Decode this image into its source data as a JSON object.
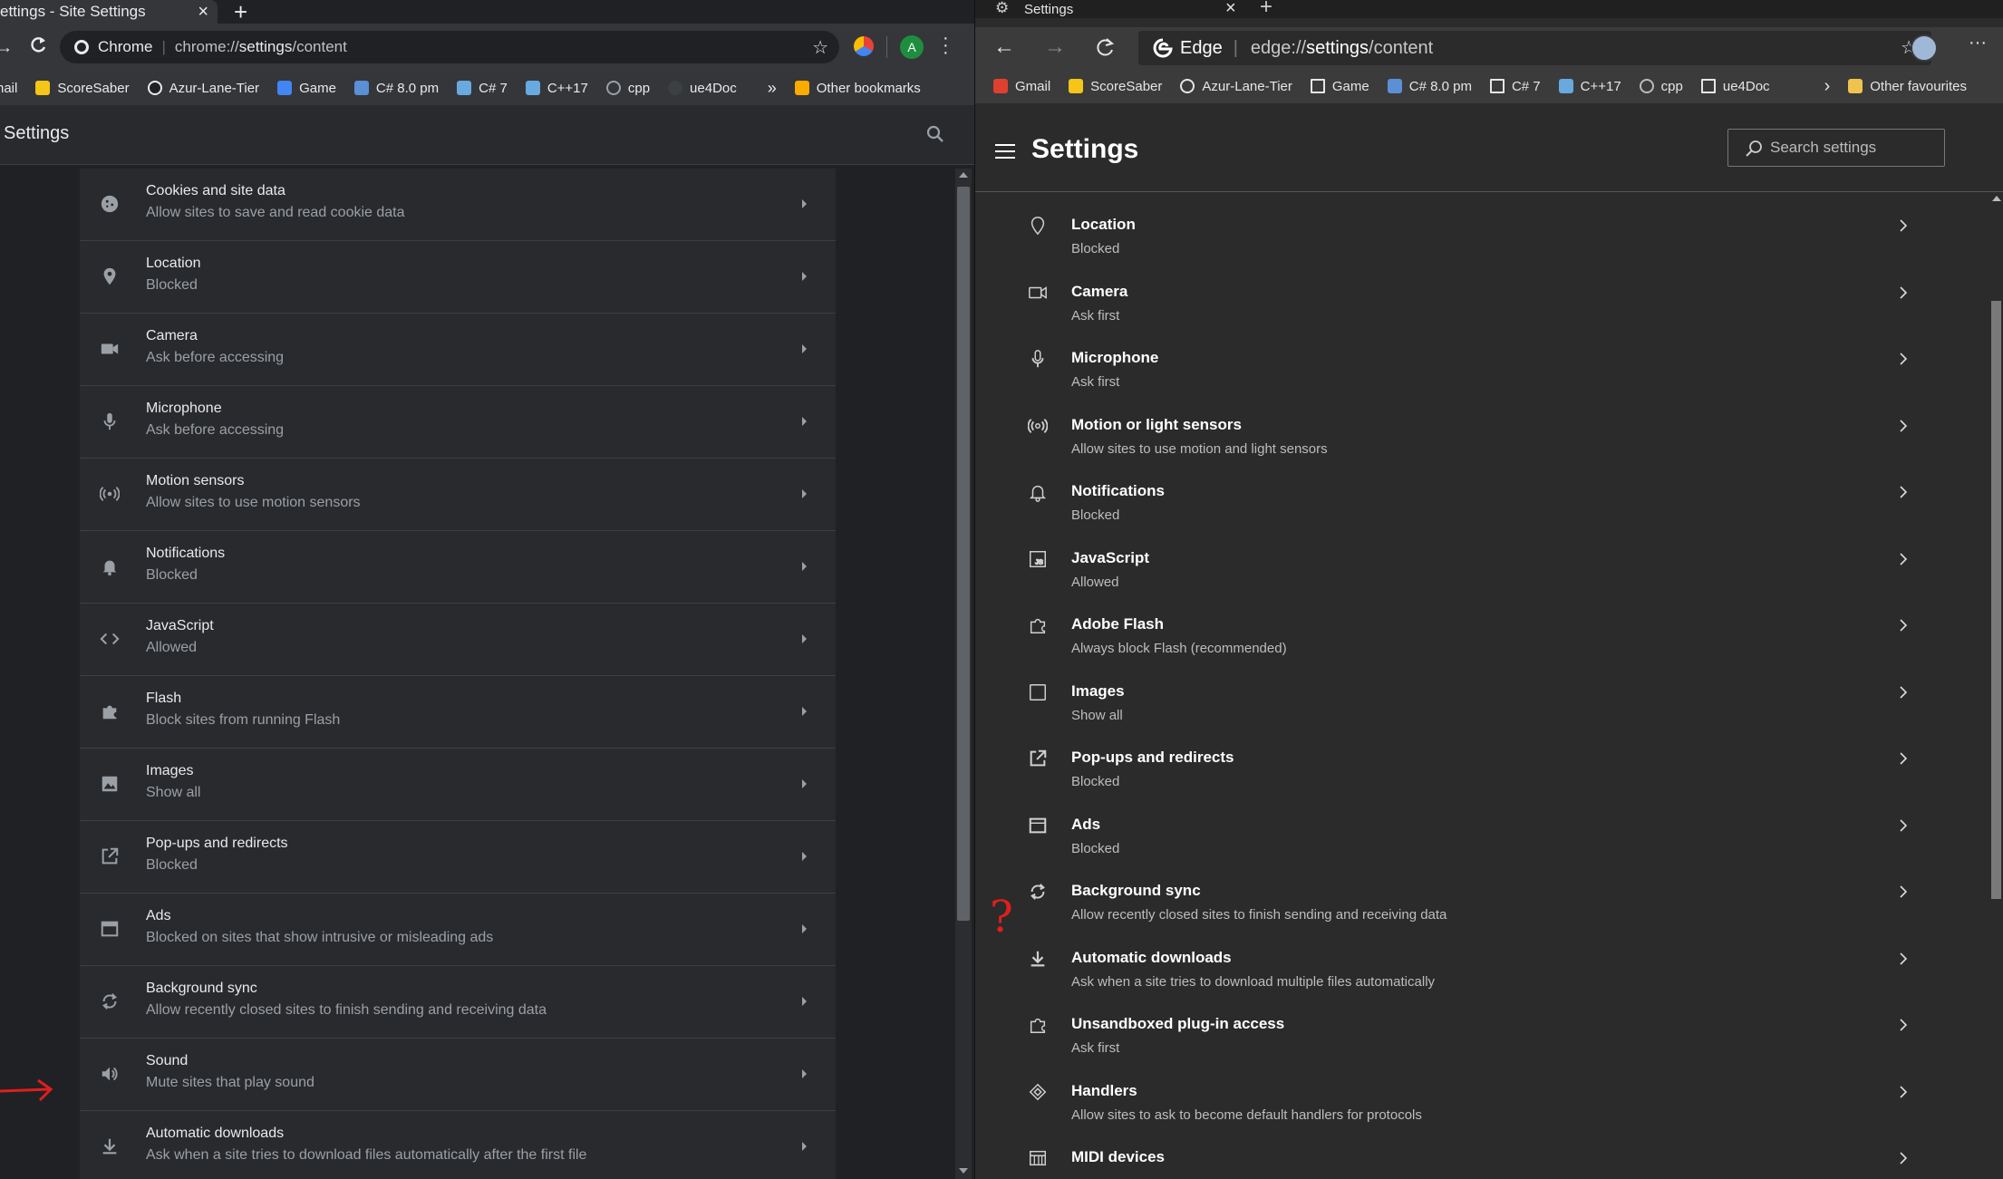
{
  "chrome": {
    "tab_title": "ettings - Site Settings",
    "omnibox": {
      "brand": "Chrome",
      "url_prefix": "chrome://",
      "url_host": "settings",
      "url_path": "/content"
    },
    "avatar_letter": "A",
    "bookmarks": [
      "nail",
      "ScoreSaber",
      "Azur-Lane-Tier",
      "Game",
      "C# 8.0 pm",
      "C# 7",
      "C++17",
      "cpp",
      "ue4Doc"
    ],
    "bookmarks_overflow": "»",
    "other_bookmarks": "Other bookmarks",
    "page_title": "Settings",
    "items": [
      {
        "title": "Cookies and site data",
        "subtitle": "Allow sites to save and read cookie data",
        "icon": "cookie-icon"
      },
      {
        "title": "Location",
        "subtitle": "Blocked",
        "icon": "location-pin-icon"
      },
      {
        "title": "Camera",
        "subtitle": "Ask before accessing",
        "icon": "camera-icon"
      },
      {
        "title": "Microphone",
        "subtitle": "Ask before accessing",
        "icon": "microphone-icon"
      },
      {
        "title": "Motion sensors",
        "subtitle": "Allow sites to use motion sensors",
        "icon": "sensors-icon"
      },
      {
        "title": "Notifications",
        "subtitle": "Blocked",
        "icon": "bell-icon"
      },
      {
        "title": "JavaScript",
        "subtitle": "Allowed",
        "icon": "code-icon"
      },
      {
        "title": "Flash",
        "subtitle": "Block sites from running Flash",
        "icon": "puzzle-icon"
      },
      {
        "title": "Images",
        "subtitle": "Show all",
        "icon": "image-icon"
      },
      {
        "title": "Pop-ups and redirects",
        "subtitle": "Blocked",
        "icon": "open-external-icon"
      },
      {
        "title": "Ads",
        "subtitle": "Blocked on sites that show intrusive or misleading ads",
        "icon": "ads-icon"
      },
      {
        "title": "Background sync",
        "subtitle": "Allow recently closed sites to finish sending and receiving data",
        "icon": "sync-icon"
      },
      {
        "title": "Sound",
        "subtitle": "Mute sites that play sound",
        "icon": "speaker-icon"
      },
      {
        "title": "Automatic downloads",
        "subtitle": "Ask when a site tries to download files automatically after the first file",
        "icon": "download-icon"
      }
    ]
  },
  "edge": {
    "tab_title": "Settings",
    "omnibox": {
      "brand": "Edge",
      "url_prefix": "edge://",
      "url_host": "settings",
      "url_path": "/content"
    },
    "bookmarks": [
      "Gmail",
      "ScoreSaber",
      "Azur-Lane-Tier",
      "Game",
      "C# 8.0 pm",
      "C# 7",
      "C++17",
      "cpp",
      "ue4Doc"
    ],
    "other_favourites": "Other favourites",
    "page_title": "Settings",
    "search_placeholder": "Search settings",
    "items": [
      {
        "title": "Location",
        "subtitle": "Blocked",
        "icon": "location-pin-icon"
      },
      {
        "title": "Camera",
        "subtitle": "Ask first",
        "icon": "camera-icon"
      },
      {
        "title": "Microphone",
        "subtitle": "Ask first",
        "icon": "microphone-icon"
      },
      {
        "title": "Motion or light sensors",
        "subtitle": "Allow sites to use motion and light sensors",
        "icon": "sensors-icon"
      },
      {
        "title": "Notifications",
        "subtitle": "Blocked",
        "icon": "bell-icon"
      },
      {
        "title": "JavaScript",
        "subtitle": "Allowed",
        "icon": "javascript-icon"
      },
      {
        "title": "Adobe Flash",
        "subtitle": "Always block Flash (recommended)",
        "icon": "puzzle-icon"
      },
      {
        "title": "Images",
        "subtitle": "Show all",
        "icon": "image-icon"
      },
      {
        "title": "Pop-ups and redirects",
        "subtitle": "Blocked",
        "icon": "open-external-icon"
      },
      {
        "title": "Ads",
        "subtitle": "Blocked",
        "icon": "ads-icon"
      },
      {
        "title": "Background sync",
        "subtitle": "Allow recently closed sites to finish sending and receiving data",
        "icon": "sync-icon"
      },
      {
        "title": "Automatic downloads",
        "subtitle": "Ask when a site tries to download multiple files automatically",
        "icon": "download-icon"
      },
      {
        "title": "Unsandboxed plug-in access",
        "subtitle": "Ask first",
        "icon": "puzzle-icon"
      },
      {
        "title": "Handlers",
        "subtitle": "Allow sites to ask to become default handlers for protocols",
        "icon": "handlers-icon"
      },
      {
        "title": "MIDI devices",
        "subtitle": "",
        "icon": "midi-icon"
      }
    ]
  },
  "annotations": {
    "question_mark": "?"
  },
  "colors": {
    "annotation_red": "#e01e1e"
  }
}
